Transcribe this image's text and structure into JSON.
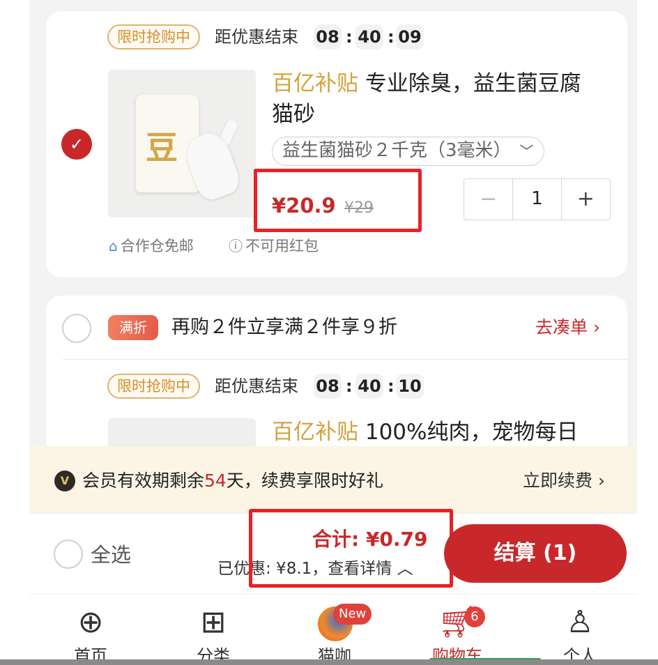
{
  "item1": {
    "flash_badge": "限时抢购中",
    "countdown_label": "距优惠结束",
    "countdown": [
      "08",
      "40",
      "09"
    ],
    "subsidy_tag": "百亿补贴",
    "title_part1": "专业除臭，益生菌豆腐",
    "title_part2": "猫砂",
    "spec": "益生菌猫砂２千克（3毫米）",
    "price": "¥20.9",
    "original_price": "¥29",
    "quantity": "1",
    "tag_warehouse": "合作仓免邮",
    "tag_no_redpacket": "不可用红包",
    "selected": true
  },
  "promo_group": {
    "badge": "满折",
    "text": "再购２件立享满２件享９折",
    "link": "去凑单",
    "selected": false
  },
  "item2": {
    "flash_badge": "限时抢购中",
    "countdown_label": "距优惠结束",
    "countdown": [
      "08",
      "40",
      "10"
    ],
    "subsidy_tag": "百亿补贴",
    "title_part1": "100%纯肉，宠物每日"
  },
  "member_bar": {
    "text_before": "会员有效期剩余",
    "days": "54",
    "text_after": "天，续费享限时好礼",
    "renew_link": "立即续费"
  },
  "checkout_bar": {
    "select_all_label": "全选",
    "total": "合计: ¥0.79",
    "saved": "已优惠: ¥8.1，查看详情",
    "checkout_button": "结算 (1)"
  },
  "tabbar": {
    "tabs": [
      {
        "label": "首页",
        "icon": "home-grid-icon"
      },
      {
        "label": "分类",
        "icon": "category-icon"
      },
      {
        "label": "猫咖",
        "icon": "cat-cafe-icon",
        "badge": "New"
      },
      {
        "label": "购物车",
        "icon": "cart-icon",
        "badge": "6",
        "active": true
      },
      {
        "label": "个人",
        "icon": "person-pro-icon"
      }
    ]
  },
  "colors": {
    "brand_red": "#c8282a",
    "subsidy_gold": "#d6a13a",
    "highlight_box": "#ea2027",
    "member_bg": "#fcf5e6"
  }
}
